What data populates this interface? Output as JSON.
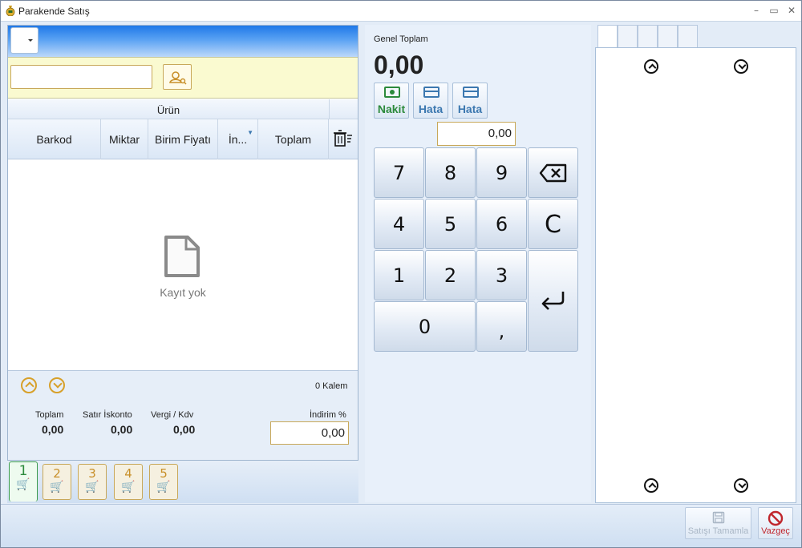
{
  "window": {
    "title": "Parakende Satış"
  },
  "grid": {
    "group_header": "Ürün",
    "columns": [
      "Barkod",
      "Miktar",
      "Birim Fiyatı",
      "İn...",
      "Toplam"
    ],
    "empty_text": "Kayıt yok"
  },
  "summary": {
    "item_count": "0 Kalem",
    "toplam_label": "Toplam",
    "toplam_value": "0,00",
    "satir_iskonto_label": "Satır İskonto",
    "satir_iskonto_value": "0,00",
    "vergi_label": "Vergi / Kdv",
    "vergi_value": "0,00",
    "indirim_label": "İndirim %",
    "indirim_value": "0,00"
  },
  "carts": [
    "1",
    "2",
    "3",
    "4",
    "5"
  ],
  "payment": {
    "genel_toplam_label": "Genel Toplam",
    "genel_toplam_value": "0,00",
    "methods": [
      {
        "label": "Nakit",
        "icon": "cash-icon",
        "color": "#2c8a3c"
      },
      {
        "label": "Hata",
        "icon": "card-icon",
        "color": "#3c78b0"
      },
      {
        "label": "Hata",
        "icon": "card-icon",
        "color": "#3c78b0"
      }
    ],
    "amount": "0,00"
  },
  "keypad": {
    "keys": [
      "7",
      "8",
      "9",
      "⌫",
      "4",
      "5",
      "6",
      "C",
      "1",
      "2",
      "3",
      "⏎",
      "0",
      ","
    ]
  },
  "footer": {
    "complete_label": "Satışı Tamamla",
    "cancel_label": "Vazgeç"
  }
}
